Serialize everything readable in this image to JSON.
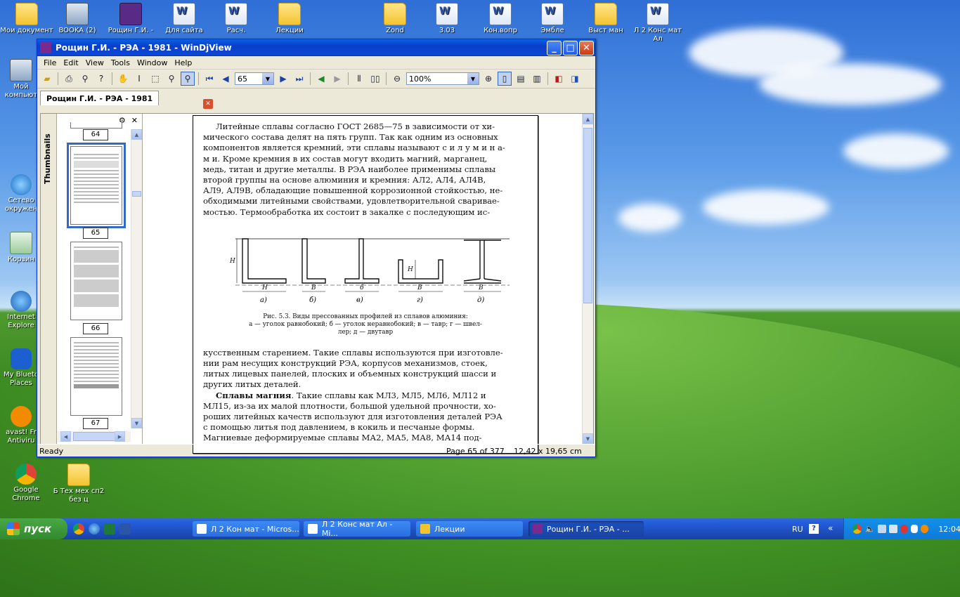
{
  "desktop": {
    "top_icons": [
      {
        "label": "Мои документ",
        "kind": "folder"
      },
      {
        "label": "BOOKA (2)",
        "kind": "pc"
      },
      {
        "label": "Рощин Г.И. -",
        "kind": "vs"
      },
      {
        "label": "Для сайта",
        "kind": "word"
      },
      {
        "label": "Расч.",
        "kind": "word"
      },
      {
        "label": "Лекции",
        "kind": "folder"
      },
      {
        "label": "Zond",
        "kind": "folder"
      },
      {
        "label": "3.03",
        "kind": "word"
      },
      {
        "label": "Кон.вопр",
        "kind": "word"
      },
      {
        "label": "Эмбле",
        "kind": "word"
      },
      {
        "label": "Выст ман",
        "kind": "folder"
      },
      {
        "label": "Л 2 Конс мат Ал",
        "kind": "word"
      }
    ],
    "left_icons": [
      {
        "label": "Мой компьют",
        "kind": "pc"
      },
      {
        "label": "Сетево окружен",
        "kind": "net"
      },
      {
        "label": "Корзин",
        "kind": "bin"
      },
      {
        "label": "Internet Explore",
        "kind": "ie"
      },
      {
        "label": "My Blueto Places",
        "kind": "bt"
      },
      {
        "label": "avast! Fr Antiviru",
        "kind": "av"
      },
      {
        "label": "Google Chrome",
        "kind": "chrome"
      },
      {
        "label": "Б Тех мех сп2 без ц",
        "kind": "folder"
      }
    ]
  },
  "window": {
    "title": "Рощин Г.И. -  РЭА - 1981 - WinDjView",
    "menu": [
      "File",
      "Edit",
      "View",
      "Tools",
      "Window",
      "Help"
    ],
    "page_combo": "65",
    "zoom_combo": "100%",
    "tab_title": "Рощин Г.И. -  РЭА - 1981",
    "sidebar_tab": "Thumbnails",
    "thumbnails": [
      "64",
      "65",
      "66",
      "67"
    ],
    "status": {
      "left": "Ready",
      "page": "Page 65 of 377",
      "size": "12,42 x 19,65 cm"
    }
  },
  "doc": {
    "para1_lines": [
      "Литейные сплавы согласно ГОСТ 2685—75 в зависимости от хи-",
      "мического состава делят на пять групп. Так как одним из основных",
      "компонентов является кремний, эти сплавы называют с и л у м и н а-",
      "м и.  Кроме кремния в их состав могут входить магний, марганец,",
      "медь, титан и другие металлы. В РЭА наиболее применимы сплавы",
      "второй группы на основе алюминия и кремния: АЛ2, АЛ4, АЛ4В,",
      "АЛ9, АЛ9В, обладающие повышенной коррозионной стойкостью, не-",
      "обходимыми литейными свойствами, удовлетворительной сваривае-",
      "мостью. Термообработка их состоит в закалке с последующим ис-"
    ],
    "fig_letters": [
      "а)",
      "б)",
      "в)",
      "г)",
      "д)"
    ],
    "fig_dims": [
      "H",
      "H",
      "B",
      "B",
      "б",
      "B",
      "H",
      "B"
    ],
    "caption_lines": [
      "Рис. 5.3. Виды прессованных профилей из сплавов алюминия:",
      "а — уголок равнобокий;  б — уголок неравнобокий;  в — тавр;  г — швел-",
      "лер;  д — двутавр"
    ],
    "para2_lines": [
      "кусственным старением. Такие сплавы используются при изготовле-",
      "нии рам несущих конструкций РЭА, корпусов механизмов, стоек,",
      "литых лицевых панелей, плоских и объемных конструкций шасси и",
      "других литых деталей."
    ],
    "para3_bold": "Сплавы магния",
    "para3_lines": [
      ". Такие сплавы как МЛ3, МЛ5,  МЛ6, МЛ12 и",
      "МЛ15, из-за их малой плотности, большой удельной прочности, хо-",
      "роших литейных качеств используют для изготовления деталей РЭА",
      "с помощью литья под давлением, в кокиль и песчаные формы.",
      "    Магниевые деформируемые сплавы МА2, МА5, МА8, МА14 под-"
    ]
  },
  "taskbar": {
    "start": "пуск",
    "tasks": [
      "Л 2 Кон мат - Micros...",
      "Л 2 Конс мат Ал - Mi...",
      "Лекции",
      "Рощин Г.И. -  РЭА - ..."
    ],
    "lang": "RU",
    "time": "12:04"
  }
}
